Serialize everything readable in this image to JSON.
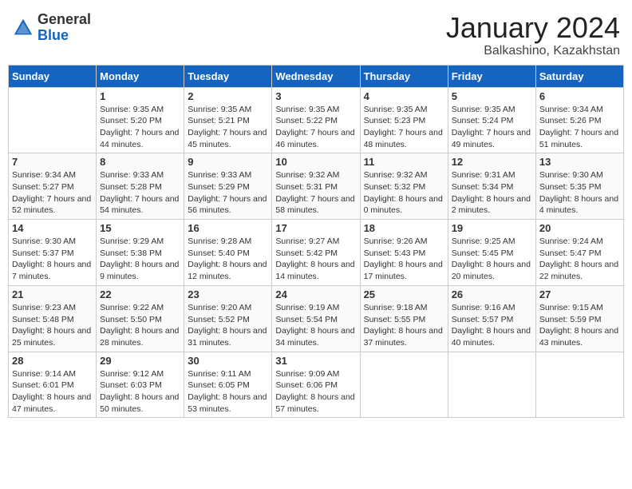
{
  "header": {
    "logo": {
      "line1": "General",
      "line2": "Blue"
    },
    "title": "January 2024",
    "subtitle": "Balkashino, Kazakhstan"
  },
  "columns": [
    "Sunday",
    "Monday",
    "Tuesday",
    "Wednesday",
    "Thursday",
    "Friday",
    "Saturday"
  ],
  "weeks": [
    [
      {
        "day": "",
        "sunrise": "",
        "sunset": "",
        "daylight": ""
      },
      {
        "day": "1",
        "sunrise": "Sunrise: 9:35 AM",
        "sunset": "Sunset: 5:20 PM",
        "daylight": "Daylight: 7 hours and 44 minutes."
      },
      {
        "day": "2",
        "sunrise": "Sunrise: 9:35 AM",
        "sunset": "Sunset: 5:21 PM",
        "daylight": "Daylight: 7 hours and 45 minutes."
      },
      {
        "day": "3",
        "sunrise": "Sunrise: 9:35 AM",
        "sunset": "Sunset: 5:22 PM",
        "daylight": "Daylight: 7 hours and 46 minutes."
      },
      {
        "day": "4",
        "sunrise": "Sunrise: 9:35 AM",
        "sunset": "Sunset: 5:23 PM",
        "daylight": "Daylight: 7 hours and 48 minutes."
      },
      {
        "day": "5",
        "sunrise": "Sunrise: 9:35 AM",
        "sunset": "Sunset: 5:24 PM",
        "daylight": "Daylight: 7 hours and 49 minutes."
      },
      {
        "day": "6",
        "sunrise": "Sunrise: 9:34 AM",
        "sunset": "Sunset: 5:26 PM",
        "daylight": "Daylight: 7 hours and 51 minutes."
      }
    ],
    [
      {
        "day": "7",
        "sunrise": "Sunrise: 9:34 AM",
        "sunset": "Sunset: 5:27 PM",
        "daylight": "Daylight: 7 hours and 52 minutes."
      },
      {
        "day": "8",
        "sunrise": "Sunrise: 9:33 AM",
        "sunset": "Sunset: 5:28 PM",
        "daylight": "Daylight: 7 hours and 54 minutes."
      },
      {
        "day": "9",
        "sunrise": "Sunrise: 9:33 AM",
        "sunset": "Sunset: 5:29 PM",
        "daylight": "Daylight: 7 hours and 56 minutes."
      },
      {
        "day": "10",
        "sunrise": "Sunrise: 9:32 AM",
        "sunset": "Sunset: 5:31 PM",
        "daylight": "Daylight: 7 hours and 58 minutes."
      },
      {
        "day": "11",
        "sunrise": "Sunrise: 9:32 AM",
        "sunset": "Sunset: 5:32 PM",
        "daylight": "Daylight: 8 hours and 0 minutes."
      },
      {
        "day": "12",
        "sunrise": "Sunrise: 9:31 AM",
        "sunset": "Sunset: 5:34 PM",
        "daylight": "Daylight: 8 hours and 2 minutes."
      },
      {
        "day": "13",
        "sunrise": "Sunrise: 9:30 AM",
        "sunset": "Sunset: 5:35 PM",
        "daylight": "Daylight: 8 hours and 4 minutes."
      }
    ],
    [
      {
        "day": "14",
        "sunrise": "Sunrise: 9:30 AM",
        "sunset": "Sunset: 5:37 PM",
        "daylight": "Daylight: 8 hours and 7 minutes."
      },
      {
        "day": "15",
        "sunrise": "Sunrise: 9:29 AM",
        "sunset": "Sunset: 5:38 PM",
        "daylight": "Daylight: 8 hours and 9 minutes."
      },
      {
        "day": "16",
        "sunrise": "Sunrise: 9:28 AM",
        "sunset": "Sunset: 5:40 PM",
        "daylight": "Daylight: 8 hours and 12 minutes."
      },
      {
        "day": "17",
        "sunrise": "Sunrise: 9:27 AM",
        "sunset": "Sunset: 5:42 PM",
        "daylight": "Daylight: 8 hours and 14 minutes."
      },
      {
        "day": "18",
        "sunrise": "Sunrise: 9:26 AM",
        "sunset": "Sunset: 5:43 PM",
        "daylight": "Daylight: 8 hours and 17 minutes."
      },
      {
        "day": "19",
        "sunrise": "Sunrise: 9:25 AM",
        "sunset": "Sunset: 5:45 PM",
        "daylight": "Daylight: 8 hours and 20 minutes."
      },
      {
        "day": "20",
        "sunrise": "Sunrise: 9:24 AM",
        "sunset": "Sunset: 5:47 PM",
        "daylight": "Daylight: 8 hours and 22 minutes."
      }
    ],
    [
      {
        "day": "21",
        "sunrise": "Sunrise: 9:23 AM",
        "sunset": "Sunset: 5:48 PM",
        "daylight": "Daylight: 8 hours and 25 minutes."
      },
      {
        "day": "22",
        "sunrise": "Sunrise: 9:22 AM",
        "sunset": "Sunset: 5:50 PM",
        "daylight": "Daylight: 8 hours and 28 minutes."
      },
      {
        "day": "23",
        "sunrise": "Sunrise: 9:20 AM",
        "sunset": "Sunset: 5:52 PM",
        "daylight": "Daylight: 8 hours and 31 minutes."
      },
      {
        "day": "24",
        "sunrise": "Sunrise: 9:19 AM",
        "sunset": "Sunset: 5:54 PM",
        "daylight": "Daylight: 8 hours and 34 minutes."
      },
      {
        "day": "25",
        "sunrise": "Sunrise: 9:18 AM",
        "sunset": "Sunset: 5:55 PM",
        "daylight": "Daylight: 8 hours and 37 minutes."
      },
      {
        "day": "26",
        "sunrise": "Sunrise: 9:16 AM",
        "sunset": "Sunset: 5:57 PM",
        "daylight": "Daylight: 8 hours and 40 minutes."
      },
      {
        "day": "27",
        "sunrise": "Sunrise: 9:15 AM",
        "sunset": "Sunset: 5:59 PM",
        "daylight": "Daylight: 8 hours and 43 minutes."
      }
    ],
    [
      {
        "day": "28",
        "sunrise": "Sunrise: 9:14 AM",
        "sunset": "Sunset: 6:01 PM",
        "daylight": "Daylight: 8 hours and 47 minutes."
      },
      {
        "day": "29",
        "sunrise": "Sunrise: 9:12 AM",
        "sunset": "Sunset: 6:03 PM",
        "daylight": "Daylight: 8 hours and 50 minutes."
      },
      {
        "day": "30",
        "sunrise": "Sunrise: 9:11 AM",
        "sunset": "Sunset: 6:05 PM",
        "daylight": "Daylight: 8 hours and 53 minutes."
      },
      {
        "day": "31",
        "sunrise": "Sunrise: 9:09 AM",
        "sunset": "Sunset: 6:06 PM",
        "daylight": "Daylight: 8 hours and 57 minutes."
      },
      {
        "day": "",
        "sunrise": "",
        "sunset": "",
        "daylight": ""
      },
      {
        "day": "",
        "sunrise": "",
        "sunset": "",
        "daylight": ""
      },
      {
        "day": "",
        "sunrise": "",
        "sunset": "",
        "daylight": ""
      }
    ]
  ]
}
